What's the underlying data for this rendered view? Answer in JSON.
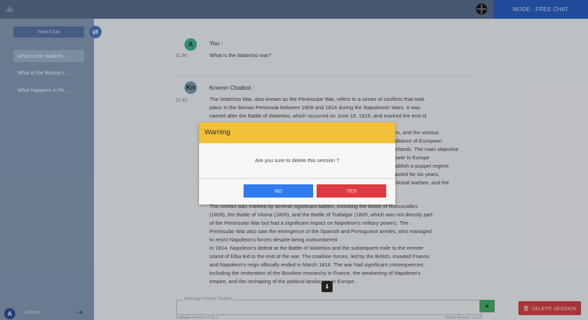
{
  "topbar": {
    "mode_label": "MODE : FREE CHAT"
  },
  "sidebar": {
    "new_chat_label": "New Chat",
    "items": [
      {
        "label": "What is the Waterlo..."
      },
      {
        "label": "What is the Boston t..."
      },
      {
        "label": "What happens in Pe..."
      }
    ],
    "user_initial": "A",
    "user_name": "Admin"
  },
  "chat": {
    "user_initial": "A",
    "user_name": "You :",
    "user_time": "11:40",
    "user_message": "What is the Waterloo war?",
    "bot_initial": "Kn",
    "bot_name": "Kneron Chatbot :",
    "bot_time": "11:42",
    "bot_lines_top": [
      "The Waterloo War, also known as the Peninsular War, refers to a series of conflicts that took",
      "place in the Iberian Peninsula between 1808 and 1814 during the Napoleonic Wars. It was",
      "named after the Battle of Waterloo, which occurred on June 18, 1815, and marked the end of"
    ],
    "bot_lines_right": [
      "on, and the various",
      "alliance of European",
      "erlands. The main objective",
      "ower in Europe",
      "tablish a puppet regime",
      "lasted for six years,",
      "ntional warfare, and the"
    ],
    "bot_lines_bottom": [
      "The conflict was marked by several significant battles, including the Battle of Roncevalles",
      "(1809), the Battle of Vitoria (1809), and the Battle of Trafalgar (1805, which was not directly part",
      "of the Peninsular War but had a significant impact on Napoleon's military power). The",
      "Peninsular War also saw the emergence of the Spanish and Portuguese armies, who managed",
      "to resist Napoleon's forces despite being outnumbered.",
      "In 1814, Napoleon's defeat at the Battle of Waterloo and the subsequent exile to the remote",
      "island of Elba led to the end of the war. The coalition forces, led by the British, invaded France,",
      "and Napoleon's reign officially ended in March 1814. The war had significant consequences,",
      "including the restoration of the Bourbon monarchy in France, the weakening of Napoleon's",
      "empire, and the reshaping of the political landscape in Europe."
    ],
    "input_placeholder": "Message Kneron Chatbot",
    "software_version": "Software Version: 0.10.1",
    "model_version": "Model Version: v1.1.2",
    "delete_session_label": "DELETE SESSION"
  },
  "modal": {
    "title": "Warning",
    "message": "Are you sure to delete this session ?",
    "no_label": "NO",
    "yes_label": "YES"
  },
  "colors": {
    "topbar": "#4f6582",
    "mode_button": "#1f55b5",
    "sidebar": "#7a8ea6",
    "modal_header": "#f2c038",
    "no_button": "#2f7cf0",
    "yes_button": "#de3b40",
    "delete_button": "#c5383a",
    "send_button": "#3fa25d"
  },
  "icons": [
    "logo-icon",
    "globe-icon",
    "swap-icon",
    "logout-icon",
    "send-icon",
    "trash-icon",
    "scroll-down-icon"
  ]
}
